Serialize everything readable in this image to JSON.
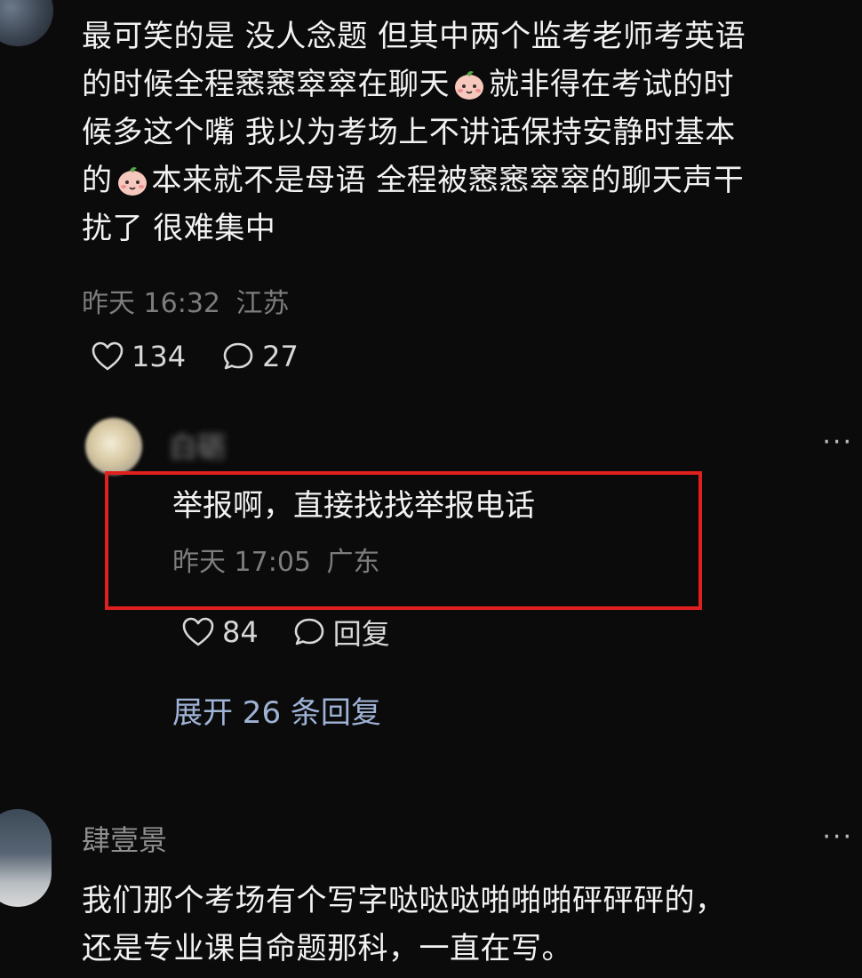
{
  "comment": {
    "lines": [
      "最可笑的是 没人念题 但其中两个监考老师考英语",
      "的时候全程窸窸窣窣在聊天",
      "就非得在考试的时",
      "候多这个嘴 我以为考场上不讲话保持安静时基本",
      "的",
      "本来就不是母语 全程被窸窸窣窣的聊天声干",
      "扰了 很难集中"
    ],
    "time": "昨天 16:32",
    "location": "江苏",
    "likes": "134",
    "replies": "27"
  },
  "reply": {
    "username": "白砺",
    "text": "举报啊，直接找找举报电话",
    "time": "昨天 17:05",
    "location": "广东",
    "likes": "84",
    "reply_label": "回复",
    "expand_label": "展开 26 条回复"
  },
  "comment2": {
    "username": "肆壹景",
    "lines": [
      "我们那个考场有个写字哒哒哒啪啪啪砰砰砰的，",
      "还是专业课自命题那科，一直在写。"
    ]
  },
  "more_label": "···",
  "colors": {
    "background": "#0b0b0b",
    "highlight": "#e01f1f",
    "link": "#9fb3d6"
  }
}
